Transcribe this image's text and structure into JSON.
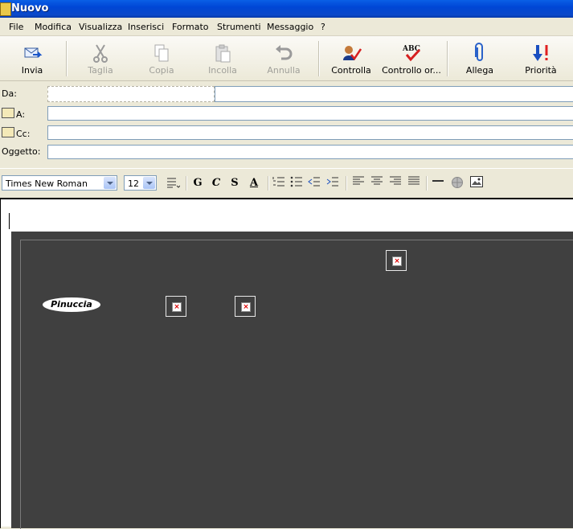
{
  "window": {
    "title": "Nuovo"
  },
  "menu": [
    "File",
    "Modifica",
    "Visualizza",
    "Inserisci",
    "Formato",
    "Strumenti",
    "Messaggio",
    "?"
  ],
  "toolbar": {
    "send": "Invia",
    "cut": "Taglia",
    "copy": "Copia",
    "paste": "Incolla",
    "undo": "Annulla",
    "check": "Controlla",
    "spell": "Controllo or...",
    "spell_icon_text": "ABC",
    "attach": "Allega",
    "priority": "Priorità"
  },
  "header": {
    "from_label": "Da:",
    "to_label": "A:",
    "cc_label": "Cc:",
    "subject_label": "Oggetto:",
    "from_value": "",
    "to_value": "",
    "cc_value": "",
    "subject_value": ""
  },
  "format": {
    "font": "Times New Roman",
    "size": "12",
    "bold": "G",
    "italic": "C",
    "underline": "S",
    "color": "A"
  },
  "body": {
    "logo_text": "Pinuccia",
    "broken_glyph": "×"
  }
}
